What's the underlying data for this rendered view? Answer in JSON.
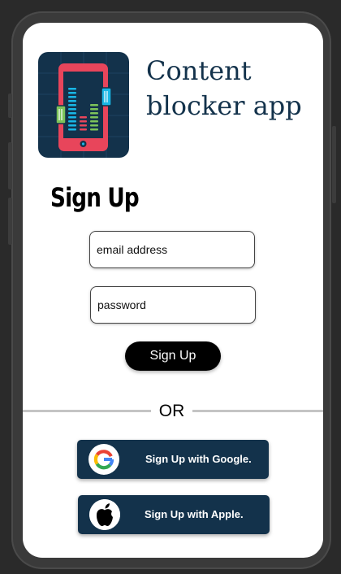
{
  "app": {
    "title": "Content blocker app",
    "logo_icon": "phone-equalizer-icon"
  },
  "form": {
    "heading": "Sign Up",
    "email_placeholder": "email address",
    "password_placeholder": "password",
    "submit_label": "Sign Up"
  },
  "divider": {
    "label": "OR"
  },
  "social": {
    "google_label": "Sign Up with Google.",
    "apple_label": "Sign Up with Apple.",
    "google_icon": "google-icon",
    "apple_icon": "apple-icon"
  },
  "colors": {
    "brand_navy": "#13324b",
    "phone_red": "#e8455b",
    "bar_cyan": "#18b7e6",
    "bar_green": "#7cc35a",
    "button_black": "#000000"
  }
}
